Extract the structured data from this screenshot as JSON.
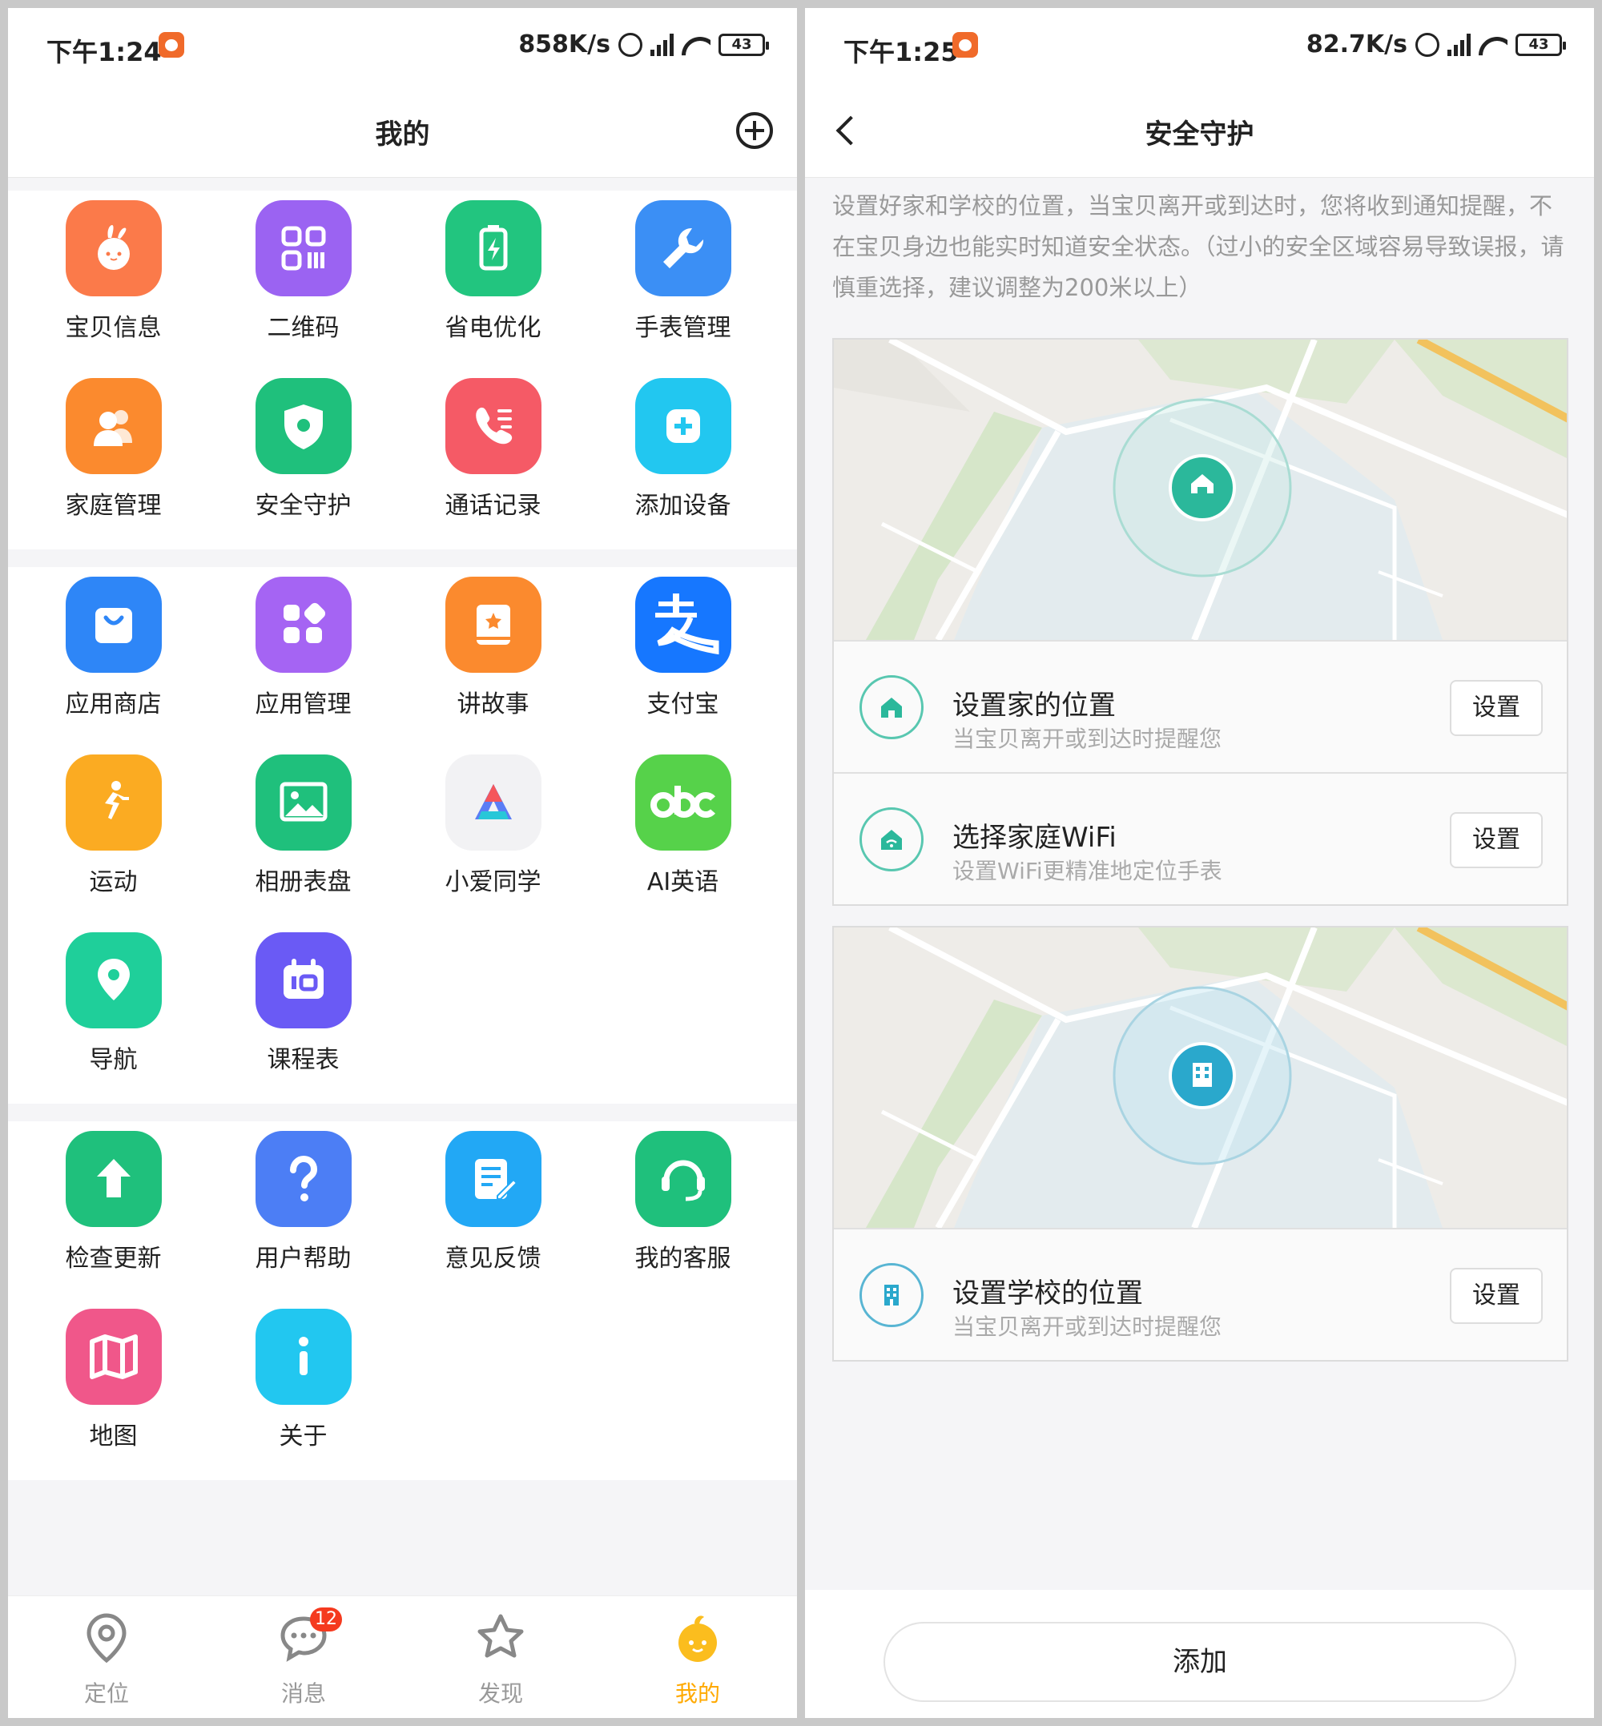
{
  "left": {
    "status": {
      "time": "下午1:24",
      "speed": "858K/s",
      "battery": "43"
    },
    "title": "我的",
    "groups": [
      [
        {
          "label": "宝贝信息",
          "icon": "rabbit-icon",
          "color": "#fb7a4a"
        },
        {
          "label": "二维码",
          "icon": "qrcode-icon",
          "color": "#9b63f2"
        },
        {
          "label": "省电优化",
          "icon": "battery-icon",
          "color": "#22c57f"
        },
        {
          "label": "手表管理",
          "icon": "wrench-icon",
          "color": "#3b8ff5"
        },
        {
          "label": "家庭管理",
          "icon": "family-icon",
          "color": "#fb8a2e"
        },
        {
          "label": "安全守护",
          "icon": "shield-icon",
          "color": "#1fc07c"
        },
        {
          "label": "通话记录",
          "icon": "phone-log-icon",
          "color": "#f55a66"
        },
        {
          "label": "添加设备",
          "icon": "add-device-icon",
          "color": "#22c7f0"
        }
      ],
      [
        {
          "label": "应用商店",
          "icon": "store-bag-icon",
          "color": "#2e86f7"
        },
        {
          "label": "应用管理",
          "icon": "apps-icon",
          "color": "#a564f3"
        },
        {
          "label": "讲故事",
          "icon": "storybook-icon",
          "color": "#fb8a2e"
        },
        {
          "label": "支付宝",
          "icon": "alipay-icon",
          "color": "#1677ff"
        },
        {
          "label": "运动",
          "icon": "runner-icon",
          "color": "#fbab22"
        },
        {
          "label": "相册表盘",
          "icon": "photo-icon",
          "color": "#1fc07c"
        },
        {
          "label": "小爱同学",
          "icon": "xiaoai-icon",
          "color": "#f2f2f4"
        },
        {
          "label": "AI英语",
          "icon": "abc-icon",
          "color": "#56d24a"
        },
        {
          "label": "导航",
          "icon": "navigation-pin-icon",
          "color": "#1fcf9a"
        },
        {
          "label": "课程表",
          "icon": "timetable-icon",
          "color": "#6a5af5"
        }
      ],
      [
        {
          "label": "检查更新",
          "icon": "update-arrow-icon",
          "color": "#1fc07c"
        },
        {
          "label": "用户帮助",
          "icon": "help-icon",
          "color": "#4c7ef5"
        },
        {
          "label": "意见反馈",
          "icon": "feedback-icon",
          "color": "#22a8f5"
        },
        {
          "label": "我的客服",
          "icon": "headset-icon",
          "color": "#1fc07c"
        },
        {
          "label": "地图",
          "icon": "map-icon",
          "color": "#f0578a"
        },
        {
          "label": "关于",
          "icon": "info-icon",
          "color": "#22c7f0"
        }
      ]
    ],
    "nav": [
      {
        "label": "定位",
        "icon": "location-pin-icon"
      },
      {
        "label": "消息",
        "icon": "message-icon",
        "badge": "12"
      },
      {
        "label": "发现",
        "icon": "star-icon"
      },
      {
        "label": "我的",
        "icon": "mascot-icon"
      }
    ]
  },
  "right": {
    "status": {
      "time": "下午1:25",
      "speed": "82.7K/s",
      "battery": "43"
    },
    "title": "安全守护",
    "description": "设置好家和学校的位置，当宝贝离开或到达时，您将收到通知提醒，不在宝贝身边也能实时知道安全状态。（过小的安全区域容易导致误报，请慎重选择，建议调整为200米以上）",
    "home_card": {
      "rows": [
        {
          "title": "设置家的位置",
          "subtitle": "当宝贝离开或到达时提醒您",
          "button": "设置",
          "icon": "home-icon"
        },
        {
          "title": "选择家庭WiFi",
          "subtitle": "设置WiFi更精准地定位手表",
          "button": "设置",
          "icon": "home-wifi-icon"
        }
      ]
    },
    "school_card": {
      "rows": [
        {
          "title": "设置学校的位置",
          "subtitle": "当宝贝离开或到达时提醒您",
          "button": "设置",
          "icon": "school-icon"
        }
      ]
    },
    "add_button": "添加",
    "accent_color": "#2bb89b"
  }
}
